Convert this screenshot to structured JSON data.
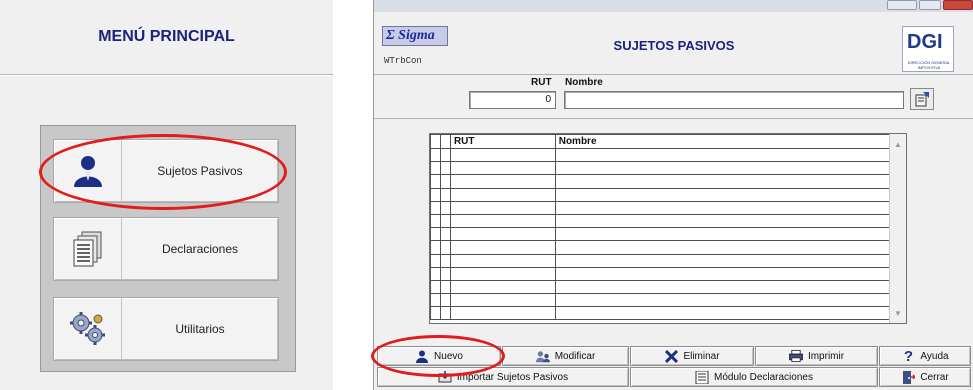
{
  "left_menu": {
    "title": "MENÚ PRINCIPAL",
    "items": [
      {
        "label": "Sujetos Pasivos",
        "icon": "person-icon"
      },
      {
        "label": "Declaraciones",
        "icon": "documents-icon"
      },
      {
        "label": "Utilitarios",
        "icon": "gears-icon"
      }
    ]
  },
  "window": {
    "badge": "Σ Sigma",
    "module_code": "WTrbCon",
    "title": "SUJETOS PASIVOS",
    "logo": {
      "mark": "DGI",
      "subtitle": "DIRECCIÓN GENERAL IMPOSITIVA"
    },
    "search": {
      "rut_label": "RUT",
      "name_label": "Nombre",
      "rut_value": "0",
      "name_value": ""
    },
    "grid": {
      "columns": [
        "RUT",
        "Nombre"
      ],
      "empty_rows": 13
    },
    "buttons": {
      "new": "Nuevo",
      "modify": "Modificar",
      "delete": "Eliminar",
      "print": "Imprimir",
      "help": "Ayuda",
      "import": "Importar Sujetos Pasivos",
      "declarations_module": "Módulo Declaraciones",
      "close": "Cerrar"
    }
  },
  "colors": {
    "title_blue": "#1a237e",
    "highlight_red": "#e21b1b",
    "window_bg": "#f0f0f0"
  }
}
